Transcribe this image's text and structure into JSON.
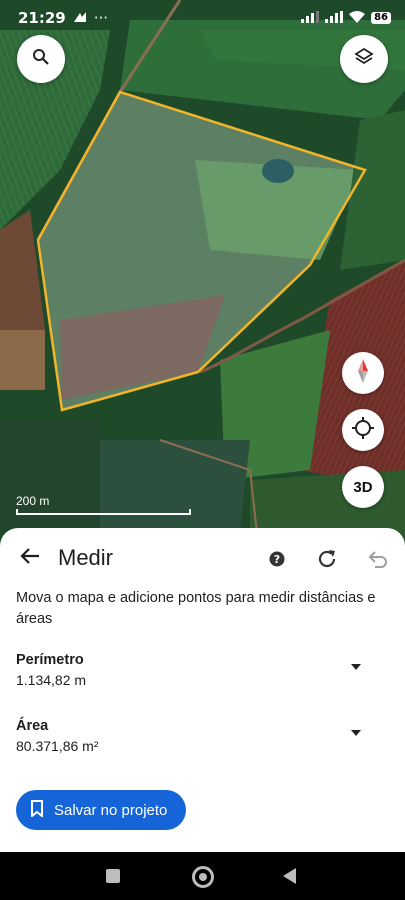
{
  "status_bar": {
    "time": "21:29",
    "more": "···",
    "battery": "86"
  },
  "map": {
    "scale_label": "200 m",
    "button_3d": "3D",
    "polygon_color": "#f2b52a"
  },
  "sheet": {
    "title": "Medir",
    "instructions": "Mova o mapa e adicione pontos para medir distâncias e áreas",
    "metrics": [
      {
        "label": "Perímetro",
        "value": "1.134,82 m"
      },
      {
        "label": "Área",
        "value": "80.371,86 m²"
      }
    ],
    "save_label": "Salvar no projeto"
  },
  "colors": {
    "accent": "#1565d8"
  }
}
